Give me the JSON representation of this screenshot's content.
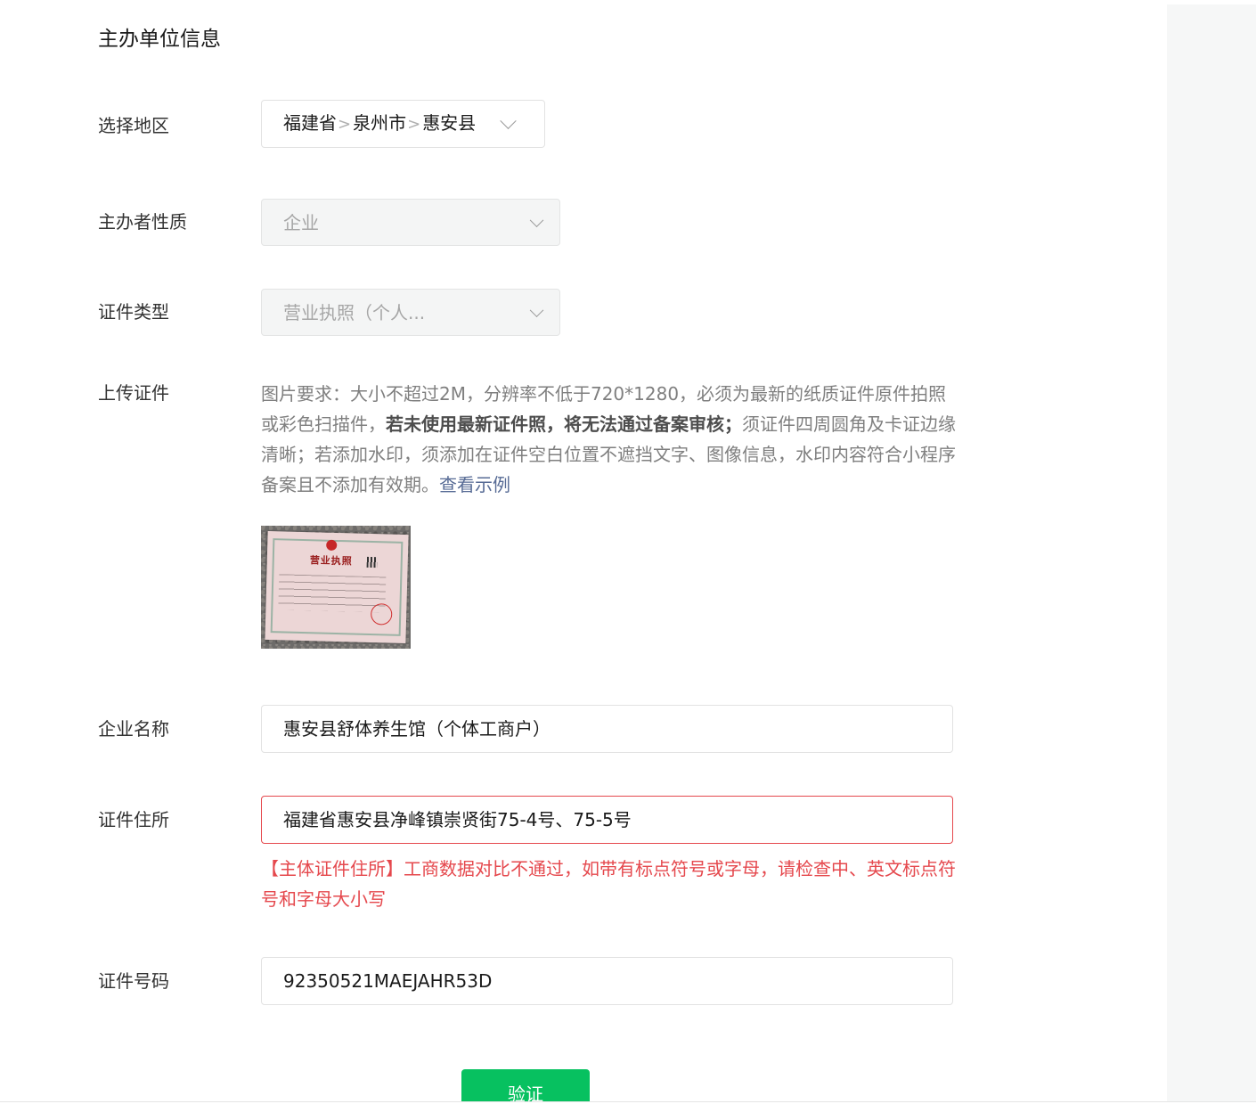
{
  "section_title": "主办单位信息",
  "fields": {
    "region": {
      "label": "选择地区",
      "province": "福建省",
      "city": "泉州市",
      "county": "惠安县",
      "separator": ">"
    },
    "organizer_type": {
      "label": "主办者性质",
      "value": "企业"
    },
    "cert_type": {
      "label": "证件类型",
      "value": "营业执照（个人..."
    },
    "upload": {
      "label": "上传证件",
      "desc_part1": "图片要求：大小不超过2M，分辨率不低于720*1280，必须为最新的纸质证件原件拍照或彩色扫描件，",
      "desc_bold": "若未使用最新证件照，将无法通过备案审核；",
      "desc_part2": "须证件四周圆角及卡证边缘清晰；若添加水印，须添加在证件空白位置不遮挡文字、图像信息，水印内容符合小程序备案且不添加有效期。",
      "example_link": "查看示例",
      "thumbnail_title": "营业执照"
    },
    "company_name": {
      "label": "企业名称",
      "value": "惠安县舒体养生馆（个体工商户）"
    },
    "cert_address": {
      "label": "证件住所",
      "value": "福建省惠安县净峰镇崇贤街75-4号、75-5号",
      "error": "【主体证件住所】工商数据对比不通过，如带有标点符号或字母，请检查中、英文标点符号和字母大小写"
    },
    "cert_number": {
      "label": "证件号码",
      "value": "92350521MAEJAHR53D"
    }
  },
  "verify_button": "验证",
  "colors": {
    "primary_green": "#07c160",
    "error_red": "#e5484d",
    "link_blue": "#576b95"
  }
}
